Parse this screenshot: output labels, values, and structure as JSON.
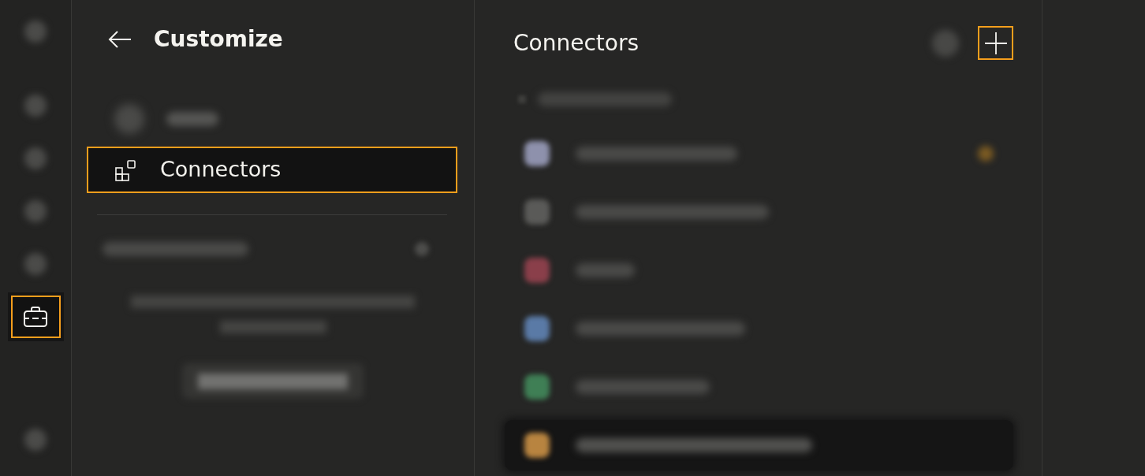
{
  "rail": {
    "top": {
      "kind": "blurred"
    },
    "items": [
      {
        "kind": "blurred",
        "selected": false,
        "highlighted": false
      },
      {
        "kind": "blurred",
        "selected": false,
        "highlighted": false
      },
      {
        "kind": "blurred",
        "selected": false,
        "highlighted": false
      },
      {
        "kind": "blurred",
        "selected": false,
        "highlighted": false
      },
      {
        "kind": "toolbox",
        "selected": true,
        "highlighted": true
      }
    ],
    "bottom": {
      "kind": "blurred"
    }
  },
  "customize": {
    "title": "Customize",
    "nav": [
      {
        "kind": "blurred",
        "selected": false,
        "highlighted": false
      },
      {
        "kind": "item",
        "label": "Connectors",
        "selected": true,
        "highlighted": true
      }
    ],
    "plugins": {
      "kind": "blurred"
    }
  },
  "connectors": {
    "title": "Connectors",
    "search": {
      "kind": "blurred"
    },
    "add_button": {
      "highlighted": true
    },
    "section": {
      "kind": "blurred"
    },
    "rows": [
      {
        "kind": "blurred",
        "color": "#8e91ac",
        "badge": true,
        "selected": false
      },
      {
        "kind": "blurred",
        "color": "#5a5a58",
        "badge": false,
        "selected": false
      },
      {
        "kind": "blurred",
        "color": "#8a3f4a",
        "badge": false,
        "selected": false
      },
      {
        "kind": "blurred",
        "color": "#5a7aa6",
        "badge": false,
        "selected": false
      },
      {
        "kind": "blurred",
        "color": "#3f7f55",
        "badge": false,
        "selected": false
      },
      {
        "kind": "blurred",
        "color": "#b88440",
        "badge": false,
        "selected": true
      }
    ]
  }
}
